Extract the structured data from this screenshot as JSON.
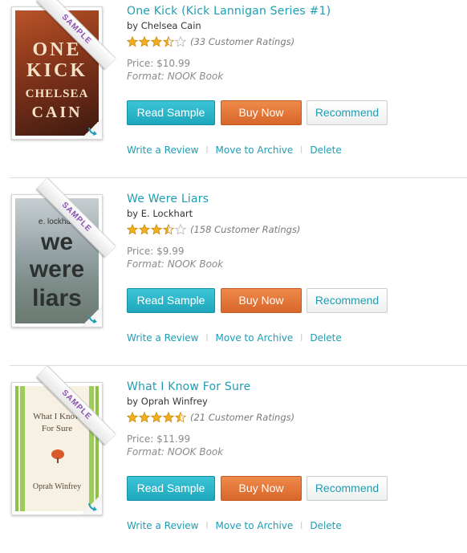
{
  "colors": {
    "accent": "#1f9db3",
    "buy": "#d8662a",
    "read": "#1fa8bd",
    "star": "#f2b01e"
  },
  "cover_badge": "SAMPLE",
  "buttons": {
    "read_sample": "Read Sample",
    "buy_now": "Buy Now",
    "recommend": "Recommend"
  },
  "links": {
    "write_review": "Write a Review",
    "archive": "Move to Archive",
    "delete": "Delete",
    "separator": "|"
  },
  "books": [
    {
      "title": "One Kick (Kick Lannigan Series #1)",
      "author": "by Chelsea Cain",
      "rating": 3.5,
      "ratings_text": "(33 Customer Ratings)",
      "price": "Price: $10.99",
      "format": "Format: NOOK Book",
      "cover": {
        "line1": "ONE",
        "line2": "KICK",
        "line3": "CHELSEA",
        "line4": "CAIN"
      }
    },
    {
      "title": "We Were Liars",
      "author": "by E. Lockhart",
      "rating": 3.5,
      "ratings_text": "(158 Customer Ratings)",
      "price": "Price: $9.99",
      "format": "Format: NOOK Book",
      "cover": {
        "line1": "e. lockhart",
        "line2": "we",
        "line3": "were",
        "line4": "liars"
      }
    },
    {
      "title": "What I Know For Sure",
      "author": "by Oprah Winfrey",
      "rating": 4.5,
      "ratings_text": "(21 Customer Ratings)",
      "price": "Price: $11.99",
      "format": "Format: NOOK Book",
      "cover": {
        "line1": "What I Know",
        "line2": "For Sure",
        "line3": "Oprah Winfrey"
      }
    }
  ]
}
